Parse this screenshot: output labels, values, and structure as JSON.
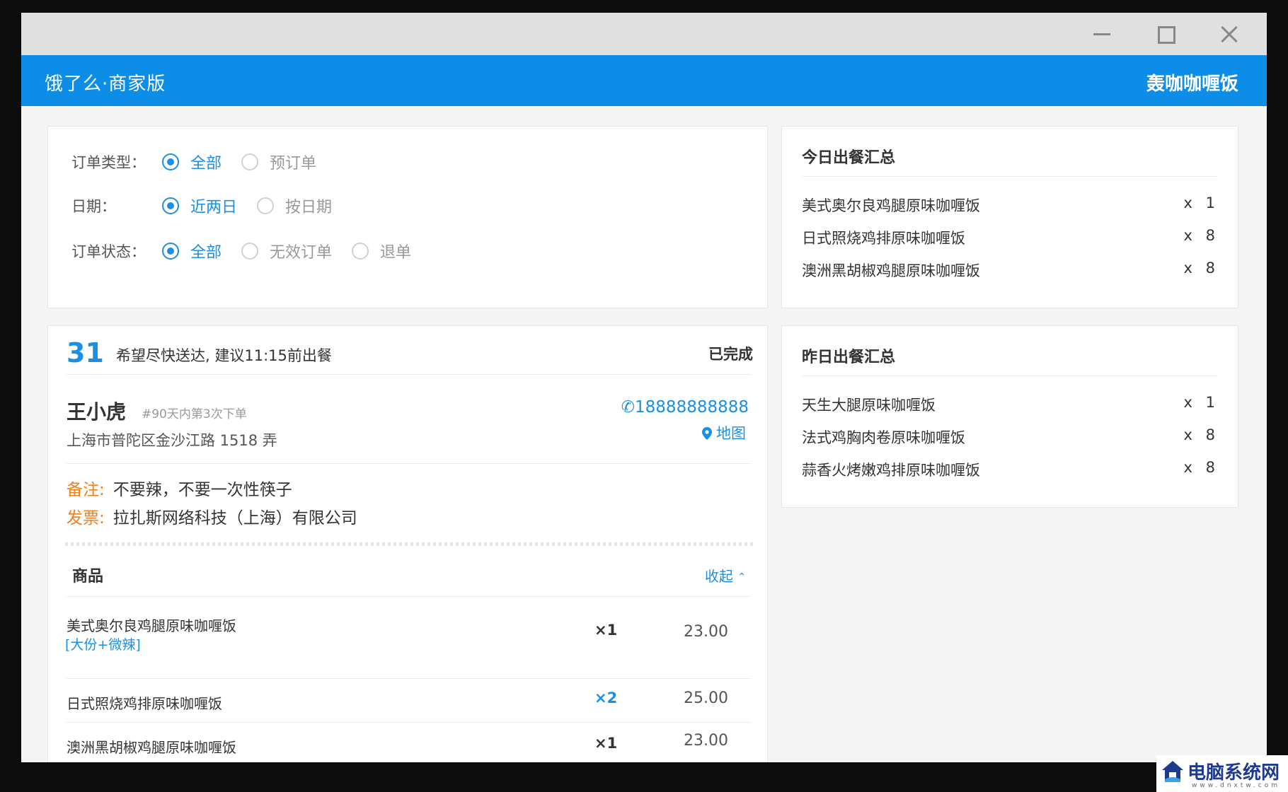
{
  "window": {
    "controls": [
      "minimize-icon",
      "maximize-icon",
      "close-icon"
    ]
  },
  "appbar": {
    "brand": "饿了么·商家版",
    "shop_name": "轰咖咖喱饭"
  },
  "filters": {
    "order_type": {
      "label": "订单类型：",
      "options": [
        "全部",
        "预订单"
      ],
      "selected": "全部"
    },
    "date": {
      "label": "日期：",
      "options": [
        "近两日",
        "按日期"
      ],
      "selected": "近两日"
    },
    "order_status": {
      "label": "订单状态：",
      "options": [
        "全部",
        "无效订单",
        "退单"
      ],
      "selected": "全部"
    }
  },
  "order": {
    "number": "31",
    "hint": "希望尽快送达, 建议11:15前出餐",
    "status": "已完成",
    "customer": {
      "name": "王小虎",
      "order_count": "#90天内第3次下单",
      "phone": "18888888888",
      "map_label": "地图",
      "address": "上海市普陀区金沙江路 1518 弄"
    },
    "remark": {
      "label": "备注:",
      "value": "不要辣，不要一次性筷子"
    },
    "invoice": {
      "label": "发票:",
      "value": "拉扎斯网络科技（上海）有限公司"
    },
    "goods": {
      "title": "商品",
      "toggle": "收起",
      "items": [
        {
          "name": "美式奥尔良鸡腿原味咖喱饭",
          "spec": "[大份+微辣]",
          "qty": "×1",
          "price": "23.00"
        },
        {
          "name": "日式照烧鸡排原味咖喱饭",
          "spec": "",
          "qty": "×2",
          "price": "25.00"
        },
        {
          "name": "澳洲黑胡椒鸡腿原味咖喱饭",
          "spec": "",
          "qty": "×1",
          "price": "23.00"
        }
      ]
    }
  },
  "today_summary": {
    "title": "今日出餐汇总",
    "items": [
      {
        "name": "美式奥尔良鸡腿原味咖喱饭",
        "qty": "x 1"
      },
      {
        "name": "日式照烧鸡排原味咖喱饭",
        "qty": "x 8"
      },
      {
        "name": "澳洲黑胡椒鸡腿原味咖喱饭",
        "qty": "x 8"
      }
    ]
  },
  "yesterday_summary": {
    "title": "昨日出餐汇总",
    "items": [
      {
        "name": "天生大腿原味咖喱饭",
        "qty": "x 1"
      },
      {
        "name": "法式鸡胸肉卷原味咖喱饭",
        "qty": "x 8"
      },
      {
        "name": "蒜香火烤嫩鸡排原味咖喱饭",
        "qty": "x 8"
      }
    ]
  },
  "watermark": {
    "text": "电脑系统网",
    "url": "www.dnxtw.com"
  },
  "colors": {
    "accent": "#0c8ee8",
    "link": "#1a8fe3",
    "label_orange": "#f17f1a"
  }
}
